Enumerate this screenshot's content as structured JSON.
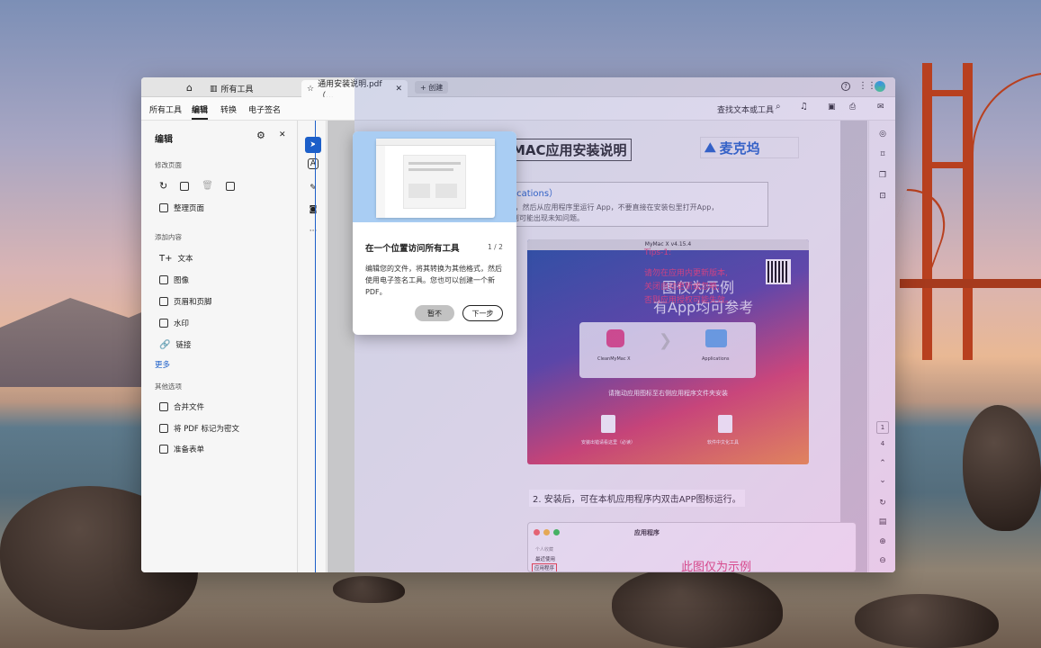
{
  "tabs": {
    "home_icon": "home-icon",
    "all_tools": "所有工具",
    "doc_tab": "通用安装说明.pdf（...",
    "create": "+ 创建"
  },
  "menubar": {
    "items": [
      "所有工具",
      "编辑",
      "转换",
      "电子签名"
    ],
    "search": "查找文本或工具"
  },
  "panel": {
    "title": "编辑",
    "sec_pages": "修改页面",
    "organize": "整理页面",
    "sec_add": "添加内容",
    "text": "文本",
    "image": "图像",
    "header_footer": "页眉和页脚",
    "watermark": "水印",
    "link": "链接",
    "more": "更多",
    "sec_other": "其他选项",
    "merge": "合并文件",
    "redact": "将 PDF 标记为密文",
    "forms": "准备表单"
  },
  "document": {
    "title": "MAC应用安装说明",
    "logo": "麦克坞",
    "step1_title": "序（Applications）",
    "step1_text": "ations)里面，然后从应用程序里运行 App，不要直接在安装包里打开App，",
    "step1_text2": "本机硬盘，则可能出现未知问题。",
    "shot_title": "MyMac X v4.15.4",
    "watermark1": "图仅为示例",
    "watermark2": "有App均可参考",
    "app1": "CleanMyMac X",
    "app2": "Applications",
    "drag_hint": "请拖动应用图标至右侧应用程序文件夹安装",
    "file1": "安装出错请看这里（必读）",
    "file2": "软件中文化工具",
    "tips_title": "Tips-1:",
    "tips1": "请勿在应用内更新版本,",
    "tips2": "关闭自动更新或忽略,",
    "tips3": "否则应用授权可能失效。",
    "step2": "2. 安装后，可在本机应用程序内双击APP图标运行。",
    "finder_title": "应用程序",
    "finder_side1": "个人收藏",
    "finder_side2": "最近使用",
    "finder_side3": "应用程序",
    "finder_wm": "此图仅为示例"
  },
  "page_nav": {
    "current": "1",
    "total": "4"
  },
  "popup": {
    "title": "在一个位置访问所有工具",
    "counter": "1 / 2",
    "body": "编辑您的文件，将其转换为其他格式，然后使用电子签名工具。您也可以创建一个新 PDF。",
    "not_now": "暂不",
    "next": "下一步"
  }
}
